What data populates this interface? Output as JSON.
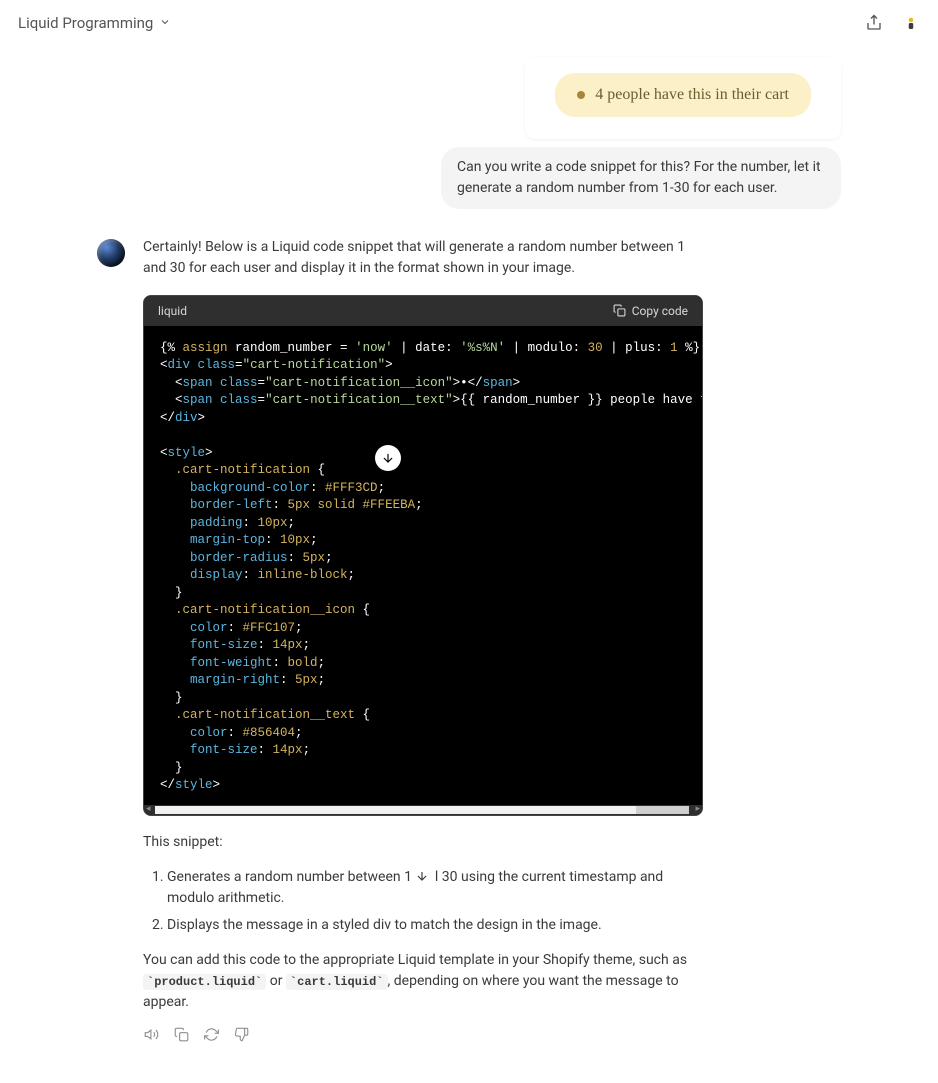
{
  "header": {
    "title": "Liquid Programming"
  },
  "user": {
    "badge_text": "4 people have this in their cart",
    "message": "Can you write a code snippet for this? For the number, let it generate a random number from 1-30 for each user."
  },
  "assistant": {
    "intro": "Certainly! Below is a Liquid code snippet that will generate a random number between 1 and 30 for each user and display it in the format shown in your image.",
    "code_lang": "liquid",
    "copy_label": "Copy code",
    "code_lines": {
      "l1a": "{% ",
      "l1b": "assign",
      "l1c": " random_number = ",
      "l1d": "'now'",
      "l1e": " | date: ",
      "l1f": "'%s%N'",
      "l1g": " | modulo: ",
      "l1h": "30",
      "l1i": " | plus: ",
      "l1j": "1",
      "l1k": " %}",
      "l2a": "<",
      "l2b": "div",
      "l2c": " class",
      "l2d": "=",
      "l2e": "\"cart-notification\"",
      "l2f": ">",
      "l3a": "  <",
      "l3b": "span",
      "l3c": " class",
      "l3d": "=",
      "l3e": "\"cart-notification__icon\"",
      "l3f": ">",
      "l3g": "•",
      "l3h": "</",
      "l3i": "span",
      "l3j": ">",
      "l4a": "  <",
      "l4b": "span",
      "l4c": " class",
      "l4d": "=",
      "l4e": "\"cart-notification__text\"",
      "l4f": ">",
      "l4g": "{{ random_number }} people have this in their cart",
      "l4h": "</",
      "l4i": "span",
      "l4j": ">",
      "l5a": "</",
      "l5b": "div",
      "l5c": ">",
      "l6": "",
      "l7a": "<",
      "l7b": "style",
      "l7c": ">",
      "l8a": "  .cart-notification",
      "l8b": " {",
      "l9a": "    background-color",
      "l9b": ": ",
      "l9c": "#FFF3CD",
      "l9d": ";",
      "l10a": "    border-left",
      "l10b": ": ",
      "l10c": "5px solid #FFEEBA",
      "l10d": ";",
      "l11a": "    padding",
      "l11b": ": ",
      "l11c": "10px",
      "l11d": ";",
      "l12a": "    margin-top",
      "l12b": ": ",
      "l12c": "10px",
      "l12d": ";",
      "l13a": "    border-radius",
      "l13b": ": ",
      "l13c": "5px",
      "l13d": ";",
      "l14a": "    display",
      "l14b": ": ",
      "l14c": "inline-block",
      "l14d": ";",
      "l15": "  }",
      "l16a": "  .cart-notification__icon",
      "l16b": " {",
      "l17a": "    color",
      "l17b": ": ",
      "l17c": "#FFC107",
      "l17d": ";",
      "l18a": "    font-size",
      "l18b": ": ",
      "l18c": "14px",
      "l18d": ";",
      "l19a": "    font-weight",
      "l19b": ": ",
      "l19c": "bold",
      "l19d": ";",
      "l20a": "    margin-right",
      "l20b": ": ",
      "l20c": "5px",
      "l20d": ";",
      "l21": "  }",
      "l22a": "  .cart-notification__text",
      "l22b": " {",
      "l23a": "    color",
      "l23b": ": ",
      "l23c": "#856404",
      "l23d": ";",
      "l24a": "    font-size",
      "l24b": ": ",
      "l24c": "14px",
      "l24d": ";",
      "l25": "  }",
      "l26a": "</",
      "l26b": "style",
      "l26c": ">"
    },
    "after_code": "This snippet:",
    "list": {
      "item1a": "Generates a random number between 1 ",
      "item1b": " l 30 using the current timestamp and modulo arithmetic.",
      "item2": "Displays the message in a styled div to match the design in the image."
    },
    "outro1": "You can add this code to the appropriate Liquid template in your Shopify theme, such as ",
    "code_inline1": "product.liquid",
    "outro2": " or ",
    "code_inline2": "cart.liquid",
    "outro3": ", depending on where you want the message to appear."
  }
}
